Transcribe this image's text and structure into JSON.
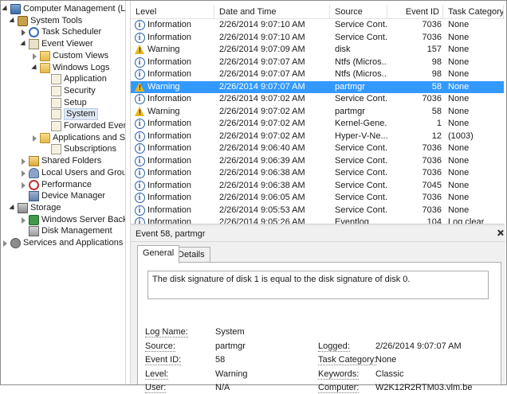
{
  "tree": {
    "items": [
      {
        "label": "Computer Management (Local",
        "icon": "computer-icon",
        "arrow": "expanded"
      },
      {
        "label": "System Tools",
        "icon": "tools-icon",
        "arrow": "expanded"
      },
      {
        "label": "Task Scheduler",
        "icon": "clock-icon",
        "arrow": "collapsed"
      },
      {
        "label": "Event Viewer",
        "icon": "event-viewer-icon",
        "arrow": "expanded"
      },
      {
        "label": "Custom Views",
        "icon": "folder-icon",
        "arrow": "collapsed"
      },
      {
        "label": "Windows Logs",
        "icon": "folder-icon",
        "arrow": "expanded"
      },
      {
        "label": "Application",
        "icon": "log-icon",
        "arrow": "none"
      },
      {
        "label": "Security",
        "icon": "log-icon",
        "arrow": "none"
      },
      {
        "label": "Setup",
        "icon": "log-icon",
        "arrow": "none"
      },
      {
        "label": "System",
        "icon": "log-icon",
        "arrow": "none",
        "selected": true
      },
      {
        "label": "Forwarded Event",
        "icon": "log-icon",
        "arrow": "none"
      },
      {
        "label": "Applications and Se",
        "icon": "folder-icon",
        "arrow": "collapsed"
      },
      {
        "label": "Subscriptions",
        "icon": "log-icon",
        "arrow": "none"
      },
      {
        "label": "Shared Folders",
        "icon": "shared-folder-icon",
        "arrow": "collapsed"
      },
      {
        "label": "Local Users and Groups",
        "icon": "users-icon",
        "arrow": "collapsed"
      },
      {
        "label": "Performance",
        "icon": "performance-icon",
        "arrow": "collapsed"
      },
      {
        "label": "Device Manager",
        "icon": "device-manager-icon",
        "arrow": "none"
      },
      {
        "label": "Storage",
        "icon": "storage-icon",
        "arrow": "expanded"
      },
      {
        "label": "Windows Server Backup",
        "icon": "backup-icon",
        "arrow": "collapsed"
      },
      {
        "label": "Disk Management",
        "icon": "disk-icon",
        "arrow": "none"
      },
      {
        "label": "Services and Applications",
        "icon": "services-icon",
        "arrow": "collapsed"
      }
    ]
  },
  "events": {
    "columns": [
      "Level",
      "Date and Time",
      "Source",
      "Event ID",
      "Task Category"
    ],
    "rows": [
      {
        "level": "Information",
        "datetime": "2/26/2014 9:07:10 AM",
        "source": "Service Cont...",
        "id": "7036",
        "category": "None"
      },
      {
        "level": "Information",
        "datetime": "2/26/2014 9:07:10 AM",
        "source": "Service Cont...",
        "id": "7036",
        "category": "None"
      },
      {
        "level": "Warning",
        "datetime": "2/26/2014 9:07:09 AM",
        "source": "disk",
        "id": "157",
        "category": "None"
      },
      {
        "level": "Information",
        "datetime": "2/26/2014 9:07:07 AM",
        "source": "Ntfs (Micros...",
        "id": "98",
        "category": "None"
      },
      {
        "level": "Information",
        "datetime": "2/26/2014 9:07:07 AM",
        "source": "Ntfs (Micros...",
        "id": "98",
        "category": "None"
      },
      {
        "level": "Warning",
        "datetime": "2/26/2014 9:07:07 AM",
        "source": "partmgr",
        "id": "58",
        "category": "None",
        "selected": true
      },
      {
        "level": "Information",
        "datetime": "2/26/2014 9:07:02 AM",
        "source": "Service Cont...",
        "id": "7036",
        "category": "None"
      },
      {
        "level": "Warning",
        "datetime": "2/26/2014 9:07:02 AM",
        "source": "partmgr",
        "id": "58",
        "category": "None"
      },
      {
        "level": "Information",
        "datetime": "2/26/2014 9:07:02 AM",
        "source": "Kernel-Gene...",
        "id": "1",
        "category": "None"
      },
      {
        "level": "Information",
        "datetime": "2/26/2014 9:07:02 AM",
        "source": "Hyper-V-Ne...",
        "id": "12",
        "category": "(1003)"
      },
      {
        "level": "Information",
        "datetime": "2/26/2014 9:06:40 AM",
        "source": "Service Cont...",
        "id": "7036",
        "category": "None"
      },
      {
        "level": "Information",
        "datetime": "2/26/2014 9:06:39 AM",
        "source": "Service Cont...",
        "id": "7036",
        "category": "None"
      },
      {
        "level": "Information",
        "datetime": "2/26/2014 9:06:38 AM",
        "source": "Service Cont...",
        "id": "7036",
        "category": "None"
      },
      {
        "level": "Information",
        "datetime": "2/26/2014 9:06:38 AM",
        "source": "Service Cont...",
        "id": "7045",
        "category": "None"
      },
      {
        "level": "Information",
        "datetime": "2/26/2014 9:06:05 AM",
        "source": "Service Cont...",
        "id": "7036",
        "category": "None"
      },
      {
        "level": "Information",
        "datetime": "2/26/2014 9:05:53 AM",
        "source": "Service Cont...",
        "id": "7036",
        "category": "None"
      },
      {
        "level": "Information",
        "datetime": "2/26/2014 9:05:26 AM",
        "source": "Eventlog",
        "id": "104",
        "category": "Log clear"
      }
    ]
  },
  "detail": {
    "title": "Event 58, partmgr",
    "tabs": [
      "General",
      "Details"
    ],
    "description": "The disk signature of disk 1 is equal to the disk signature of disk 0.",
    "left_props": [
      {
        "key": "Log Name:",
        "value": "System"
      },
      {
        "key": "Source:",
        "value": "partmgr"
      },
      {
        "key": "Event ID:",
        "value": "58"
      },
      {
        "key": "Level:",
        "value": "Warning"
      },
      {
        "key": "User:",
        "value": "N/A"
      }
    ],
    "right_props": [
      {
        "key": "Logged:",
        "value": "2/26/2014 9:07:07 AM"
      },
      {
        "key": "Task Category:",
        "value": "None"
      },
      {
        "key": "Keywords:",
        "value": "Classic"
      },
      {
        "key": "Computer:",
        "value": "W2K12R2RTM03.vlm.be"
      }
    ]
  }
}
